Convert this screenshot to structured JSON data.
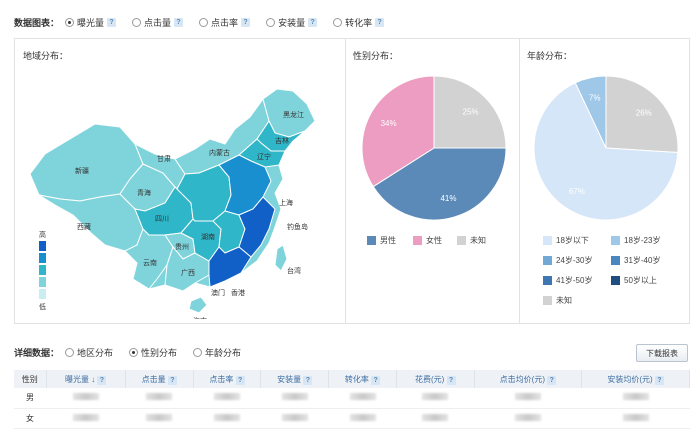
{
  "metrics_bar": {
    "label": "数据图表：",
    "options": [
      {
        "label": "曝光量",
        "selected": true
      },
      {
        "label": "点击量",
        "selected": false
      },
      {
        "label": "点击率",
        "selected": false
      },
      {
        "label": "安装量",
        "selected": false
      },
      {
        "label": "转化率",
        "selected": false
      }
    ],
    "help_glyph": "?"
  },
  "region_panel": {
    "title": "地域分布：",
    "legend_high": "高",
    "legend_low": "低",
    "provinces": [
      "新疆",
      "西藏",
      "青海",
      "甘肃",
      "内蒙古",
      "黑龙江",
      "吉林",
      "辽宁",
      "四川",
      "云南",
      "广西",
      "湖南",
      "贵州",
      "海南",
      "澳门",
      "香港",
      "钓鱼岛",
      "台湾",
      "上海"
    ],
    "colors": {
      "light": "#7fd4dc",
      "mid": "#2fb6c8",
      "dark": "#1a8fd0",
      "darkest": "#1060c8"
    }
  },
  "gender_panel": {
    "title": "性别分布：",
    "chart_data": {
      "type": "pie",
      "labels": [
        "男性",
        "女性",
        "未知"
      ],
      "values": [
        41,
        34,
        25
      ],
      "value_labels": [
        "41%",
        "34%",
        "25%"
      ],
      "colors": [
        "#5b8ab8",
        "#ec9dc1",
        "#d2d2d2"
      ],
      "legend_position": "bottom"
    }
  },
  "age_panel": {
    "title": "年龄分布：",
    "chart_data": {
      "type": "pie",
      "labels": [
        "18岁以下",
        "18岁-23岁",
        "24岁-30岁",
        "31岁-40岁",
        "41岁-50岁",
        "50岁以上",
        "未知"
      ],
      "values": [
        67,
        7,
        0,
        0,
        0,
        0,
        26
      ],
      "value_labels": [
        "67%",
        "7%",
        "",
        "",
        "",
        "",
        "26%"
      ],
      "colors": [
        "#d4e6f7",
        "#9fc7e8",
        "#72a8d6",
        "#4a87c1",
        "#3d76b0",
        "#1f4d82",
        "#d2d2d2"
      ],
      "legend_position": "bottom"
    }
  },
  "detail_bar": {
    "label": "详细数据：",
    "options": [
      {
        "label": "地区分布",
        "selected": false
      },
      {
        "label": "性别分布",
        "selected": true
      },
      {
        "label": "年龄分布",
        "selected": false
      }
    ]
  },
  "download_button": {
    "label": "下载报表"
  },
  "table": {
    "first_header": "性别",
    "sort_glyph": "↓",
    "columns": [
      "曝光量",
      "点击量",
      "点击率",
      "安装量",
      "转化率",
      "花费(元)",
      "点击均价(元)",
      "安装均价(元)"
    ],
    "rows": [
      "男",
      "女"
    ]
  }
}
